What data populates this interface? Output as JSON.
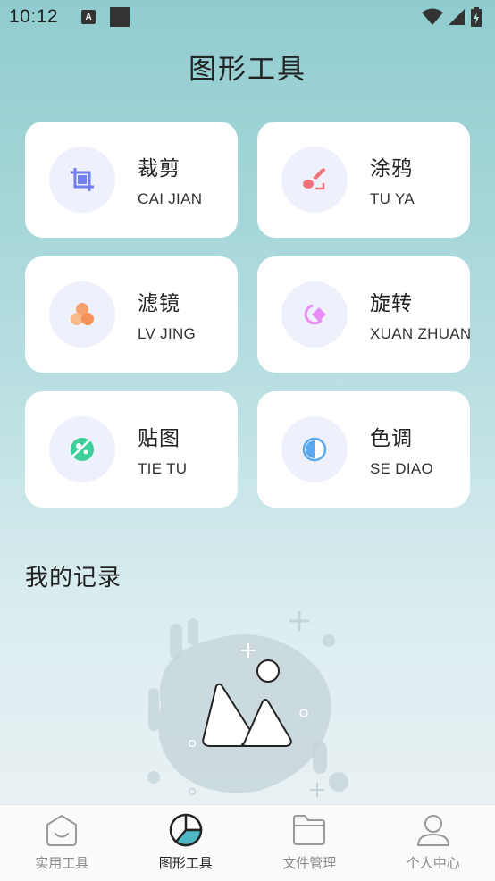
{
  "status_bar": {
    "time": "10:12",
    "notification_letter": "A"
  },
  "header": {
    "title": "图形工具"
  },
  "tools": [
    {
      "name": "裁剪",
      "pinyin": "CAI JIAN",
      "icon": "crop-icon",
      "color": "#6f7ff0"
    },
    {
      "name": "涂鸦",
      "pinyin": "TU YA",
      "icon": "brush-icon",
      "color": "#f2727a"
    },
    {
      "name": "滤镜",
      "pinyin": "LV JING",
      "icon": "filter-icon",
      "color": "#f9a16c"
    },
    {
      "name": "旋转",
      "pinyin": "XUAN ZHUAN",
      "icon": "rotate-icon",
      "color": "#e98cf5"
    },
    {
      "name": "贴图",
      "pinyin": "TIE TU",
      "icon": "sticker-icon",
      "color": "#3fcf9a"
    },
    {
      "name": "色调",
      "pinyin": "SE DIAO",
      "icon": "tone-icon",
      "color": "#5aa9f0"
    }
  ],
  "records": {
    "title": "我的记录"
  },
  "bottom_nav": {
    "items": [
      {
        "label": "实用工具",
        "icon": "home-icon"
      },
      {
        "label": "图形工具",
        "icon": "chart-icon"
      },
      {
        "label": "文件管理",
        "icon": "folder-icon"
      },
      {
        "label": "个人中心",
        "icon": "user-icon"
      }
    ],
    "active": "图形工具"
  }
}
